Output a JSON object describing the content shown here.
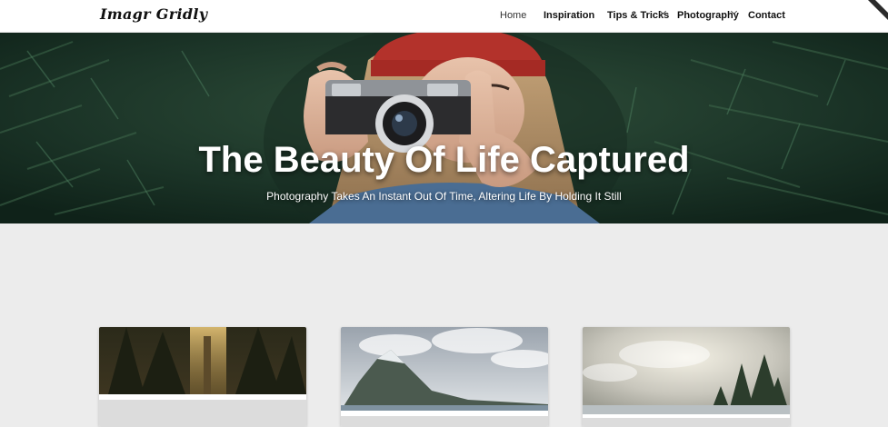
{
  "header": {
    "logo_text": "Imagr Gridly",
    "nav": [
      {
        "label": "Home",
        "has_dropdown": false
      },
      {
        "label": "Inspiration",
        "has_dropdown": false
      },
      {
        "label": "Tips & Tricks",
        "has_dropdown": true
      },
      {
        "label": "Photography",
        "has_dropdown": true
      },
      {
        "label": "Contact",
        "has_dropdown": false
      }
    ]
  },
  "hero": {
    "title": "The Beauty Of Life Captured",
    "subtitle": "Photography Takes An Instant Out Of Time, Altering Life By Holding It Still"
  },
  "cards": [
    {
      "image": "forest-sunlight-photo"
    },
    {
      "image": "mountain-lake-photo"
    },
    {
      "image": "pine-trees-sky-photo"
    }
  ],
  "colors": {
    "background": "#ececec",
    "header_bg": "#ffffff",
    "hero_text": "#ffffff"
  }
}
